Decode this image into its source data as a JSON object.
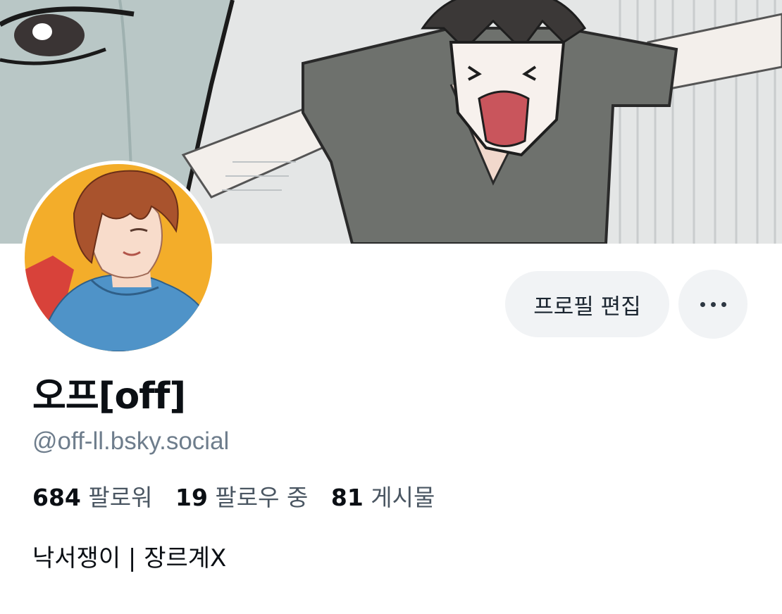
{
  "banner": {
    "description_hidden": ""
  },
  "profile": {
    "display_name": "오프[off]",
    "handle": "@off-ll.bsky.social",
    "bio": "낙서쟁이 | 장르계X"
  },
  "stats": [
    {
      "number": "684",
      "label": "팔로워"
    },
    {
      "number": "19",
      "label": "팔로우 중"
    },
    {
      "number": "81",
      "label": "게시물"
    }
  ],
  "actions": {
    "edit_profile_label": "프로필 편집",
    "more_icon": "ellipsis-icon"
  },
  "colors": {
    "button_bg": "#f1f3f5",
    "handle": "#6e7d8c",
    "text": "#0b0f14"
  }
}
